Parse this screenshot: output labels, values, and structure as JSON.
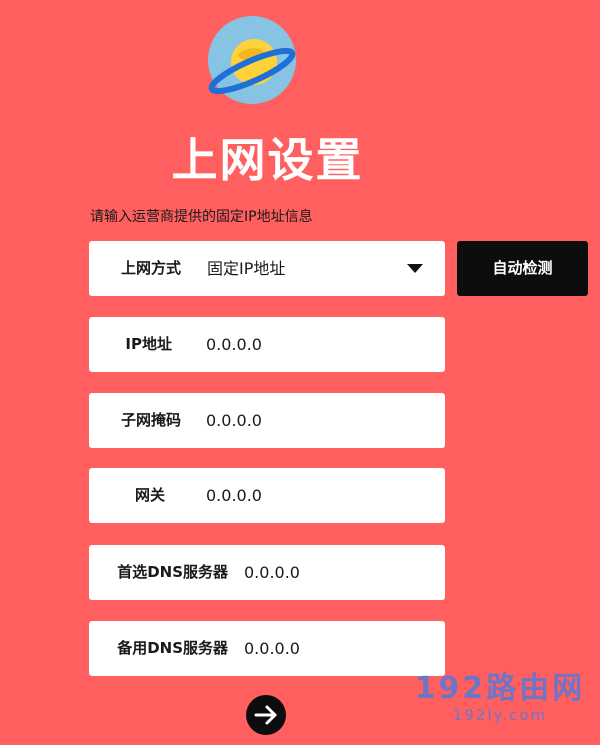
{
  "header": {
    "logo_icon": "planet-icon",
    "title": "上网设置",
    "hint": "请输入运营商提供的固定IP地址信息"
  },
  "form": {
    "connection_type": {
      "label": "上网方式",
      "value": "固定IP地址"
    },
    "ip_address": {
      "label": "IP地址",
      "value": "0.0.0.0"
    },
    "subnet_mask": {
      "label": "子网掩码",
      "value": "0.0.0.0"
    },
    "gateway": {
      "label": "网关",
      "value": "0.0.0.0"
    },
    "primary_dns": {
      "label": "首选DNS服务器",
      "value": "0.0.0.0"
    },
    "secondary_dns": {
      "label": "备用DNS服务器",
      "value": "0.0.0.0"
    }
  },
  "buttons": {
    "auto_detect": "自动检测",
    "next_icon": "arrow-right-icon"
  },
  "watermark": {
    "main": "192路由网",
    "sub": "192ly.com"
  },
  "colors": {
    "background": "#ff5f5f",
    "button": "#0d0d0d",
    "field": "#ffffff",
    "watermark": "#5878d8"
  }
}
